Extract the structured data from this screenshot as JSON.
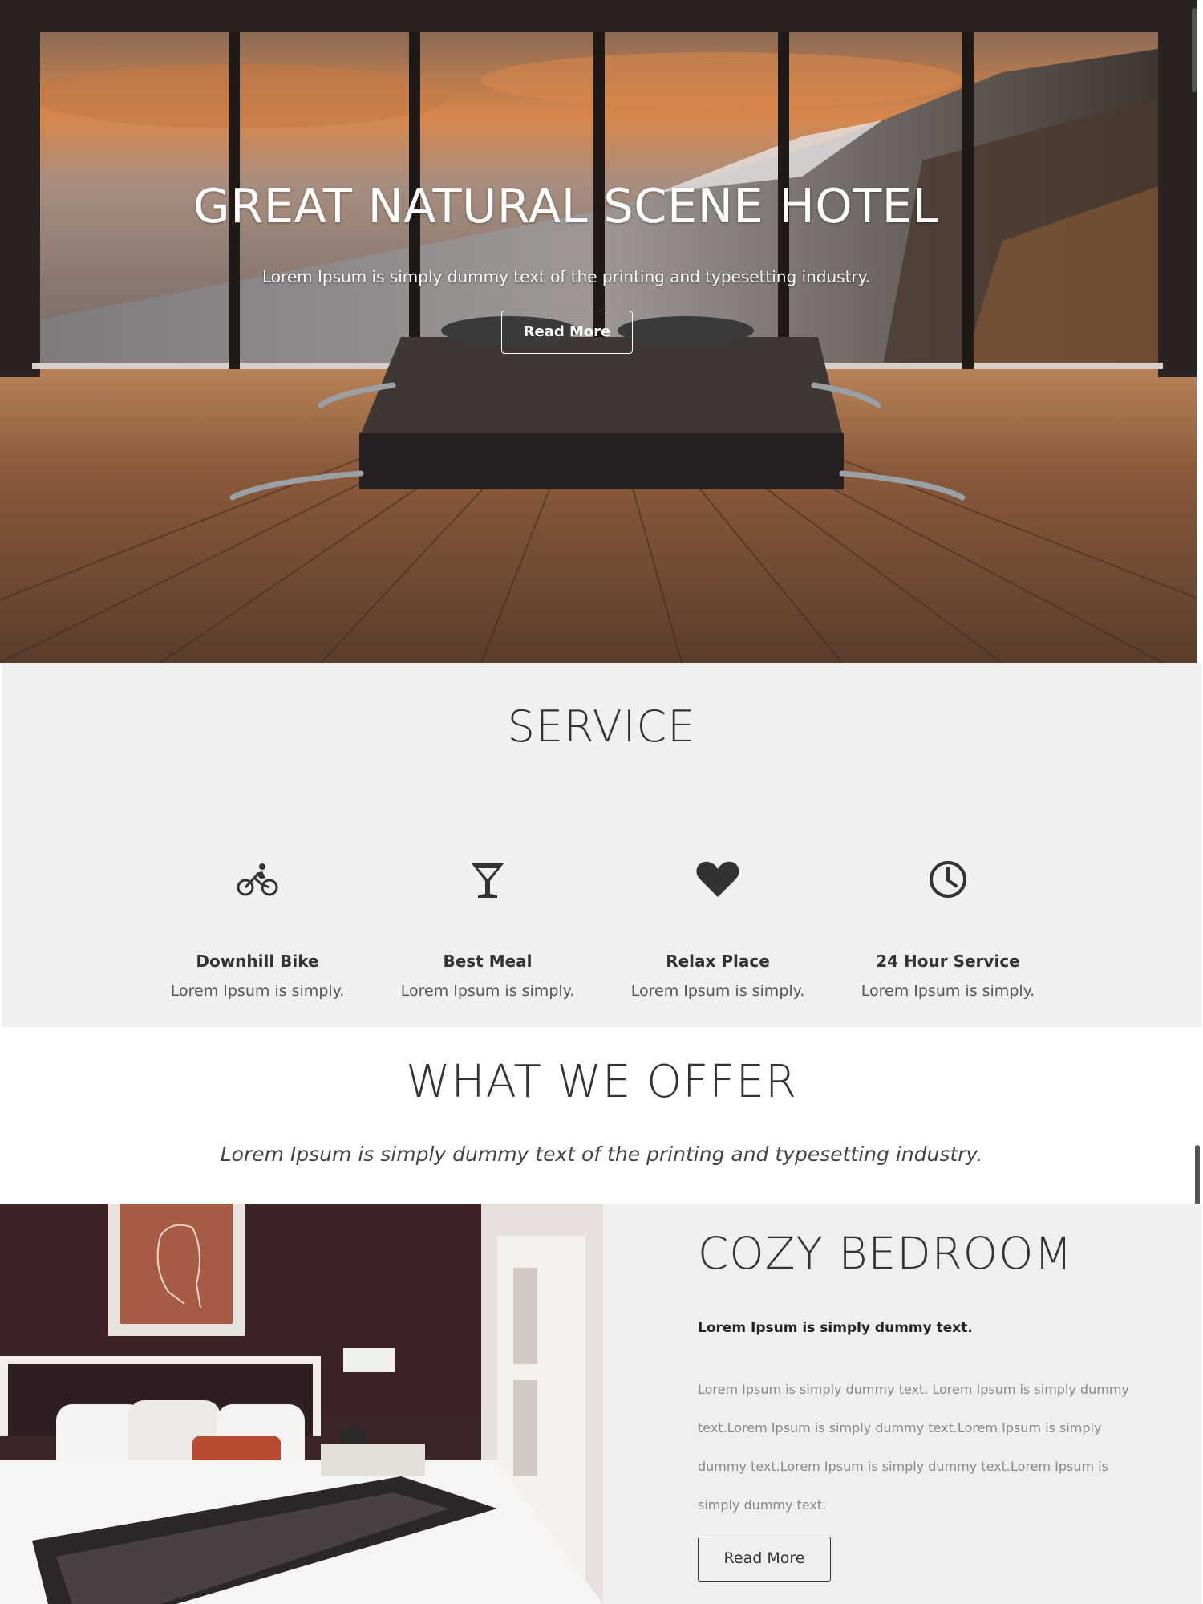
{
  "hero": {
    "title": "GREAT NATURAL SCENE HOTEL",
    "subtitle": "Lorem Ipsum is simply dummy text of the printing and typesetting industry.",
    "button_label": "Read More"
  },
  "service": {
    "title": "SERVICE",
    "items": [
      {
        "icon": "bicycle-icon",
        "name": "Downhill Bike",
        "desc": "Lorem Ipsum is simply."
      },
      {
        "icon": "cocktail-icon",
        "name": "Best Meal",
        "desc": "Lorem Ipsum is simply."
      },
      {
        "icon": "heart-icon",
        "name": "Relax Place",
        "desc": "Lorem Ipsum is simply."
      },
      {
        "icon": "clock-icon",
        "name": "24 Hour Service",
        "desc": "Lorem Ipsum is simply."
      }
    ]
  },
  "offer": {
    "title": "WHAT WE OFFER",
    "subtitle": "Lorem Ipsum is simply dummy text of the printing and typesetting industry.",
    "feature": {
      "title": "COZY BEDROOM",
      "lead": "Lorem Ipsum is simply dummy text.",
      "text": "Lorem Ipsum is simply dummy text. Lorem Ipsum is simply dummy text.Lorem Ipsum is simply dummy text.Lorem Ipsum is simply dummy text.Lorem Ipsum is simply dummy text.Lorem Ipsum is simply dummy text.",
      "button_label": "Read More"
    }
  },
  "colors": {
    "section_bg": "#f0f0f0",
    "heading_text": "#333333",
    "hero_text": "#ffffff"
  }
}
